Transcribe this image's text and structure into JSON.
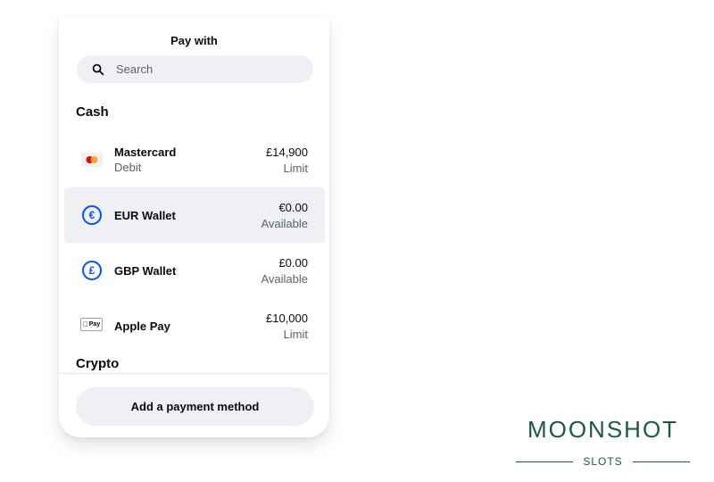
{
  "header": {
    "title": "Pay with"
  },
  "search": {
    "placeholder": "Search"
  },
  "sections": {
    "cash": "Cash",
    "crypto": "Crypto"
  },
  "methods": [
    {
      "name": "Mastercard",
      "subtitle": "Debit",
      "amount": "£14,900",
      "amount_label": "Limit",
      "icon": "mastercard-icon"
    },
    {
      "name": "EUR Wallet",
      "subtitle": "",
      "amount": "€0.00",
      "amount_label": "Available",
      "icon": "euro-icon",
      "selected": true
    },
    {
      "name": "GBP Wallet",
      "subtitle": "",
      "amount": "£0.00",
      "amount_label": "Available",
      "icon": "pound-icon"
    },
    {
      "name": "Apple Pay",
      "subtitle": "",
      "amount": "£10,000",
      "amount_label": "Limit",
      "icon": "apple-pay-icon"
    }
  ],
  "icons": {
    "euro_glyph": "€",
    "pound_glyph": "£",
    "apple_pay_text": "Pay"
  },
  "footer": {
    "add_button": "Add a payment method"
  },
  "watermark": {
    "brand": "MOONSHOT",
    "sub": "SLOTS"
  },
  "colors": {
    "accent": "#0052ff",
    "row_highlight": "#eef0f3",
    "brand": "#1a5a45"
  }
}
